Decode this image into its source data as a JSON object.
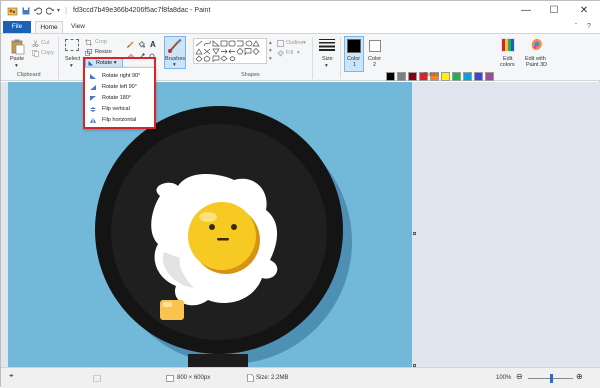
{
  "window": {
    "title": "fd3ccd7b49e366b4206f5ac7f8fa8dac - Paint",
    "controls": {
      "minimize": "—",
      "maximize": "☐",
      "close": "✕"
    },
    "quick_access": [
      "save-icon",
      "undo-icon",
      "redo-icon"
    ]
  },
  "tabs": {
    "file": "File",
    "home": "Home",
    "view": "View"
  },
  "ribbon": {
    "clipboard": {
      "label": "Clipboard",
      "paste": "Paste",
      "cut": "Cut",
      "copy": "Copy"
    },
    "image": {
      "select": "Select",
      "crop": "Crop",
      "resize": "Resize",
      "rotate": "Rotate"
    },
    "tools": {
      "brushes": "Brushes"
    },
    "shapes": {
      "label": "Shapes",
      "outline": "Outline",
      "fill": "Fill"
    },
    "size": {
      "label": "Size"
    },
    "colors": {
      "label": "Colors",
      "color1": "Color\n1",
      "color1_a": "Color",
      "color1_b": "1",
      "color2_a": "Color",
      "color2_b": "2",
      "edit_colors_a": "Edit",
      "edit_colors_b": "colors",
      "edit_paint3d_a": "Edit with",
      "edit_paint3d_b": "Paint 3D",
      "palette_row1": [
        "#000000",
        "#7f7f7f",
        "#880015",
        "#ed1c24",
        "#ff7f27",
        "#fff200",
        "#22b14c",
        "#00a2e8",
        "#3f48cc",
        "#a349a4"
      ],
      "palette_row2": [
        "#ffffff",
        "#c3c3c3",
        "#b97a57",
        "#ffaec9",
        "#ffc90e",
        "#efe4b0",
        "#b5e61d",
        "#99d9ea",
        "#7092be",
        "#c8bfe7"
      ],
      "palette_row3": [
        "#ffffff",
        "#ffffff",
        "#ffffff",
        "#ffffff",
        "#ffffff",
        "#ffffff",
        "#ffffff",
        "#ffffff",
        "#ffffff",
        "#ffffff"
      ]
    }
  },
  "rotate_menu": {
    "items": [
      "Rotate right 90°",
      "Rotate left 90°",
      "Rotate 180°",
      "Flip vertical",
      "Flip horizontal"
    ]
  },
  "status": {
    "dimensions": "800 × 600px",
    "size": "Size: 2.2MB",
    "zoom": "100%",
    "zoom_level": 0.5
  }
}
